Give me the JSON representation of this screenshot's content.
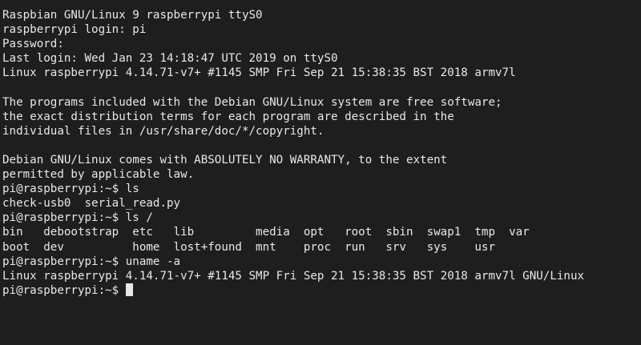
{
  "terminal": {
    "lines": [
      "Raspbian GNU/Linux 9 raspberrypi ttyS0",
      "raspberrypi login: pi",
      "Password:",
      "Last login: Wed Jan 23 14:18:47 UTC 2019 on ttyS0",
      "Linux raspberrypi 4.14.71-v7+ #1145 SMP Fri Sep 21 15:38:35 BST 2018 armv7l",
      "",
      "The programs included with the Debian GNU/Linux system are free software;",
      "the exact distribution terms for each program are described in the",
      "individual files in /usr/share/doc/*/copyright.",
      "",
      "Debian GNU/Linux comes with ABSOLUTELY NO WARRANTY, to the extent",
      "permitted by applicable law.",
      "pi@raspberrypi:~$ ls",
      "check-usb0  serial_read.py",
      "pi@raspberrypi:~$ ls /",
      "bin   debootstrap  etc   lib         media  opt   root  sbin  swap1  tmp  var",
      "boot  dev          home  lost+found  mnt    proc  run   srv   sys    usr",
      "pi@raspberrypi:~$ uname -a",
      "Linux raspberrypi 4.14.71-v7+ #1145 SMP Fri Sep 21 15:38:35 BST 2018 armv7l GNU/Linux"
    ],
    "prompt": "pi@raspberrypi:~$ "
  }
}
